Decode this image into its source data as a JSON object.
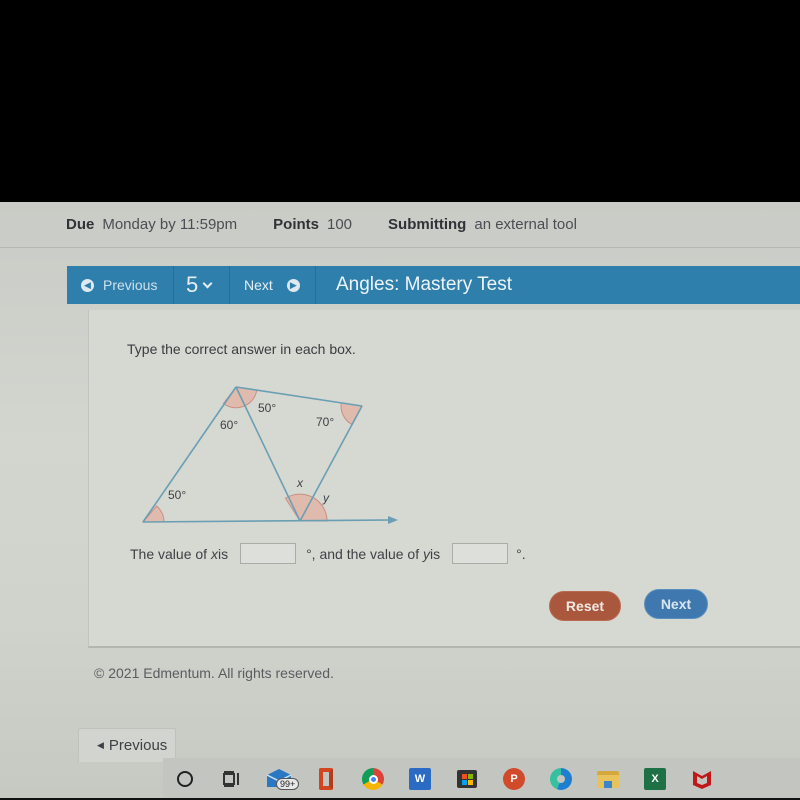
{
  "assignment_meta": {
    "due_label": "Due",
    "due_value": "Monday by 11:59pm",
    "points_label": "Points",
    "points_value": "100",
    "submitting_label": "Submitting",
    "submitting_value": "an external tool"
  },
  "navbar": {
    "previous_label": "Previous",
    "question_number": "5",
    "next_label": "Next",
    "title": "Angles: Mastery Test"
  },
  "question": {
    "instruction": "Type the correct answer in each box.",
    "diagram": {
      "angle_labels": {
        "bottom_left": "50°",
        "top_left": "60°",
        "top_right_of_apex": "50°",
        "right_vertex": "70°",
        "x": "x",
        "y": "y"
      }
    },
    "answer_sentence": {
      "part1": "The value of ",
      "var_x": "x",
      "part2": " is",
      "part3": "°, and the value of ",
      "var_y": "y",
      "part4": " is",
      "part5": "°."
    },
    "x_value": "",
    "y_value": "",
    "reset_label": "Reset",
    "next_label": "Next"
  },
  "footer": {
    "copyright": "© 2021 Edmentum. All rights reserved."
  },
  "bottom_nav": {
    "previous_label": "Previous"
  },
  "taskbar": {
    "items": [
      {
        "icon": "search-circle-icon"
      },
      {
        "icon": "task-view-icon"
      },
      {
        "icon": "mail-icon",
        "badge": "99+"
      },
      {
        "icon": "office-icon"
      },
      {
        "icon": "chrome-icon"
      },
      {
        "icon": "word-icon",
        "glyph": "W"
      },
      {
        "icon": "store-icon"
      },
      {
        "icon": "powerpoint-icon",
        "glyph": "P"
      },
      {
        "icon": "edge-icon"
      },
      {
        "icon": "file-explorer-icon"
      },
      {
        "icon": "excel-icon",
        "glyph": "X"
      },
      {
        "icon": "mcafee-icon"
      }
    ]
  },
  "colors": {
    "nav_blue": "#2f7fad",
    "reset_button": "#a9583e",
    "next_button": "#3e78ae",
    "diagram_line": "#6a9fb3",
    "angle_fill": "#e3b5a8"
  }
}
